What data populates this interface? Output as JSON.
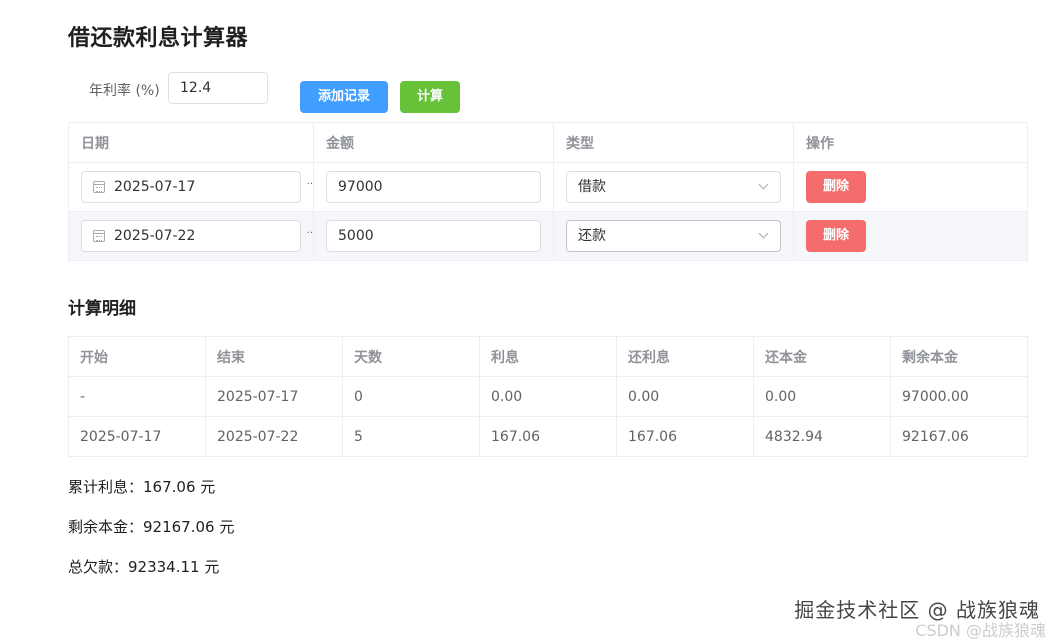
{
  "title": "借还款利息计算器",
  "rate": {
    "label": "年利率 (%)",
    "value": "12.4"
  },
  "buttons": {
    "add": "添加记录",
    "calc": "计算",
    "delete": "删除"
  },
  "records": {
    "headers": [
      "日期",
      "金额",
      "类型",
      "操作"
    ],
    "rows": [
      {
        "date": "2025-07-17",
        "amount": "97000",
        "type": "借款"
      },
      {
        "date": "2025-07-22",
        "amount": "5000",
        "type": "还款"
      }
    ]
  },
  "details": {
    "title": "计算明细",
    "headers": [
      "开始",
      "结束",
      "天数",
      "利息",
      "还利息",
      "还本金",
      "剩余本金"
    ],
    "rows": [
      [
        "-",
        "2025-07-17",
        "0",
        "0.00",
        "0.00",
        "0.00",
        "97000.00"
      ],
      [
        "2025-07-17",
        "2025-07-22",
        "5",
        "167.06",
        "167.06",
        "4832.94",
        "92167.06"
      ]
    ]
  },
  "summary": {
    "total_interest": "累计利息：167.06 元",
    "remaining_principal": "剩余本金：92167.06 元",
    "total_owed": "总欠款：92334.11 元"
  },
  "watermark": {
    "line1": "掘金技术社区 @ 战族狼魂",
    "line2": "CSDN @战族狼魂"
  },
  "colors": {
    "primary": "#409eff",
    "success": "#67c23a",
    "danger": "#f56c6c"
  }
}
